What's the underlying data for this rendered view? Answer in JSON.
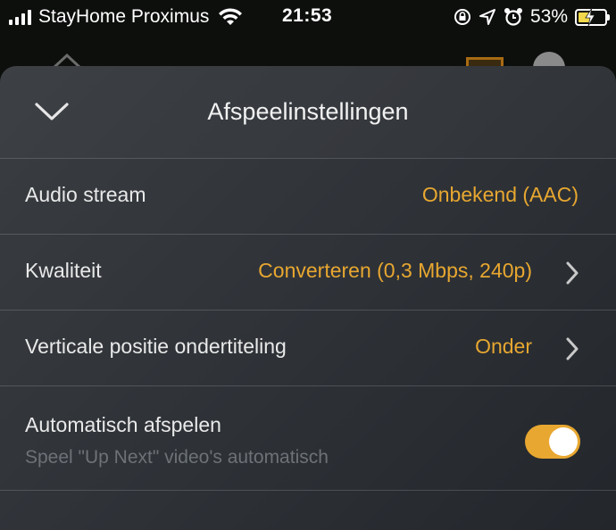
{
  "status_bar": {
    "carrier": "StayHome Proximus",
    "time": "21:53",
    "battery_percent": "53%",
    "battery_level": 0.53,
    "icons": [
      "signal-icon",
      "wifi-icon",
      "orientation-lock-icon",
      "location-icon",
      "alarm-icon",
      "battery-icon"
    ]
  },
  "sheet": {
    "title": "Afspeelinstellingen",
    "rows": [
      {
        "label": "Audio stream",
        "value": "Onbekend (AAC)"
      },
      {
        "label": "Kwaliteit",
        "value": "Converteren (0,3 Mbps, 240p)"
      },
      {
        "label": "Verticale positie ondertiteling",
        "value": "Onder"
      },
      {
        "label": "Automatisch afspelen",
        "sublabel": "Speel \"Up Next\" video's automatisch",
        "toggle_on": true
      }
    ]
  },
  "colors": {
    "accent": "#e8a730",
    "sheet_bg": "#33373c",
    "text_primary": "#e9e9e9",
    "text_secondary": "#6d7278"
  }
}
